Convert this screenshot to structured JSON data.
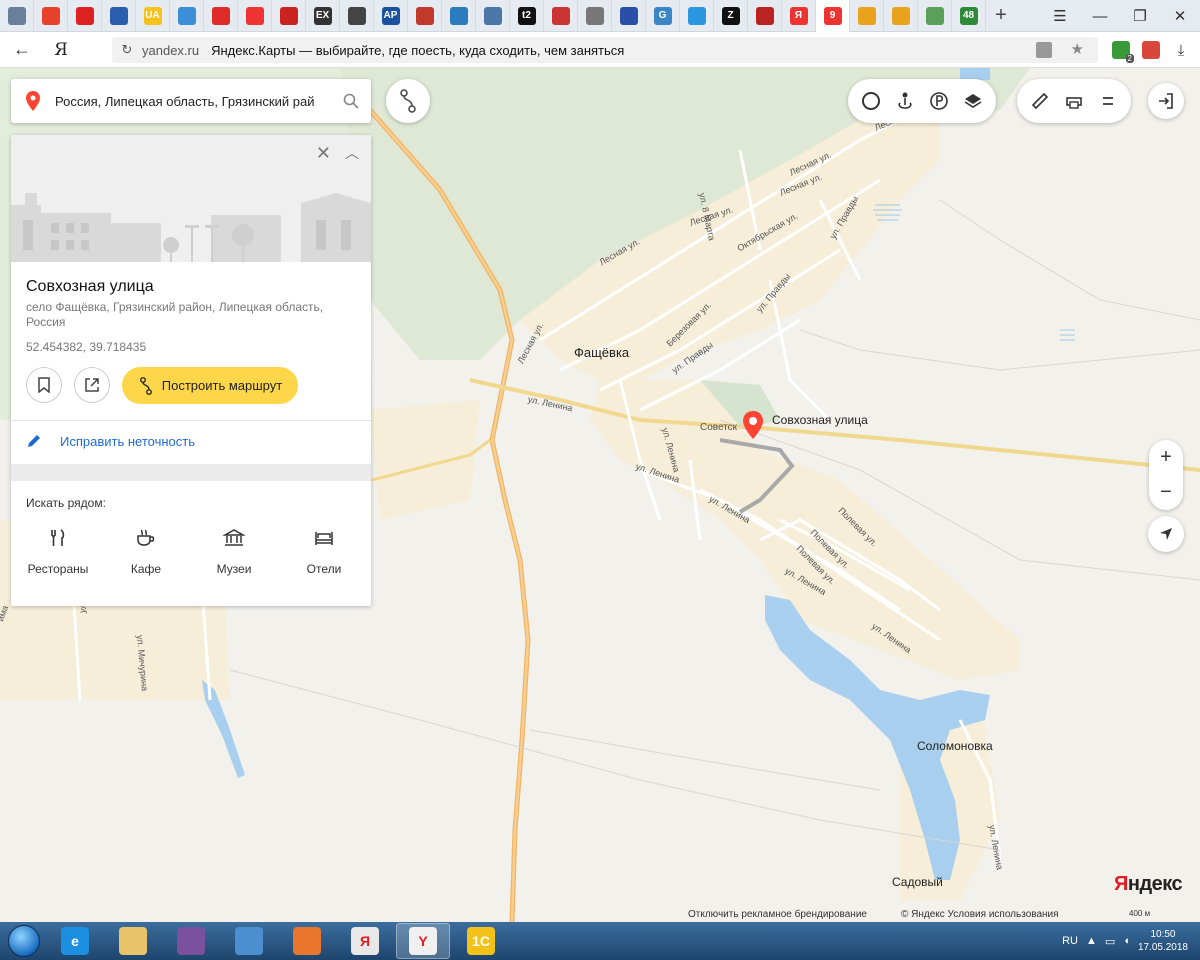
{
  "tabs": [
    {
      "icon": "cloud-icon",
      "label": "",
      "color": "#6a7f99"
    },
    {
      "icon": "ali-icon",
      "label": "",
      "color": "#e8412c"
    },
    {
      "icon": "cherry-icon",
      "label": "",
      "color": "#d22"
    },
    {
      "icon": "grid-icon",
      "label": "",
      "color": "#2b5eae"
    },
    {
      "icon": "ua-icon",
      "label": "UA",
      "color": "#f6c11a"
    },
    {
      "icon": "target-icon",
      "label": "",
      "color": "#3c8ed8"
    },
    {
      "icon": "video-icon",
      "label": "",
      "color": "#e02b2b"
    },
    {
      "icon": "lifebuoy-icon",
      "label": "",
      "color": "#e33"
    },
    {
      "icon": "star-icon",
      "label": "",
      "color": "#c22"
    },
    {
      "icon": "ex-icon",
      "label": "EX",
      "color": "#333"
    },
    {
      "icon": "bookmark-icon",
      "label": "",
      "color": "#444"
    },
    {
      "icon": "ap-icon",
      "label": "AP",
      "color": "#1a52a0"
    },
    {
      "icon": "flower-icon",
      "label": "",
      "color": "#c0392b"
    },
    {
      "icon": "shield-icon",
      "label": "",
      "color": "#2a7bbf"
    },
    {
      "icon": "vk-icon",
      "label": "",
      "color": "#4a76a8"
    },
    {
      "icon": "t2-icon",
      "label": "t2",
      "color": "#111"
    },
    {
      "icon": "globe-icon",
      "label": "",
      "color": "#c33"
    },
    {
      "icon": "document-icon",
      "label": "",
      "color": "#777"
    },
    {
      "icon": "flag-ru-icon",
      "label": "",
      "color": "#2a4fa8"
    },
    {
      "icon": "g-icon",
      "label": "G",
      "color": "#3b86c6"
    },
    {
      "icon": "dots-icon",
      "label": "",
      "color": "#2d96e0"
    },
    {
      "icon": "z-icon",
      "label": "Z",
      "color": "#111"
    },
    {
      "icon": "flag-uk-icon",
      "label": "",
      "color": "#b22"
    },
    {
      "icon": "yandex-icon",
      "label": "Я",
      "color": "#e33"
    },
    {
      "icon": "maps-pin-icon",
      "label": "9",
      "color": "#e33"
    },
    {
      "icon": "sunset-icon",
      "label": "",
      "color": "#e8a21c"
    },
    {
      "icon": "sunset-icon-2",
      "label": "",
      "color": "#e8a21c"
    },
    {
      "icon": "disk-icon",
      "label": "",
      "color": "#5aa05a"
    },
    {
      "icon": "number-icon",
      "label": "48",
      "color": "#2f8a3a"
    }
  ],
  "browser": {
    "new_tab": "+",
    "back": "←",
    "ya_button": "Я",
    "reload": "↻",
    "url_domain": "yandex.ru",
    "page_title": "Яндекс.Карты — выбирайте, где поесть, куда сходить, чем заняться",
    "star": "★",
    "ext_badge": "2"
  },
  "search": {
    "value": "Россия, Липецкая область, Грязинский рай"
  },
  "card": {
    "title": "Совхозная улица",
    "address": "село Фащёвка, Грязинский район, Липецкая область, Россия",
    "coords": "52.454382, 39.718435",
    "route_button": "Построить маршрут",
    "fix_inaccuracy": "Исправить неточность",
    "nearby_title": "Искать рядом:",
    "nearby": [
      {
        "label": "Рестораны",
        "icon": "fork-knife-icon"
      },
      {
        "label": "Кафе",
        "icon": "cup-icon"
      },
      {
        "label": "Музеи",
        "icon": "museum-icon"
      },
      {
        "label": "Отели",
        "icon": "bed-icon"
      }
    ]
  },
  "map": {
    "marker_label": "Совхозная улица",
    "places": {
      "fashchevka": "Фащёвка",
      "solomonovka": "Соломоновка",
      "sadovy": "Садовый"
    },
    "streets": {
      "lesnaya1": "Лесная ул.",
      "lesnaya2": "Лесная ул.",
      "lesnaya3": "Лесная ул.",
      "lesnaya4": "Лесная ул.",
      "lesnaya5": "Лесная ул.",
      "lesnaya6": "Лесная ул.",
      "marta": "ул. 8 Марта",
      "oktyabrskaya": "Октябрьская ул.",
      "pravdy1": "ул. Правды",
      "pravdy2": "ул. Правды",
      "pravdy3": "ул. Правды",
      "berezovaya": "Березовая ул.",
      "lenina1": "ул. Ленина",
      "lenina2": "ул. Ленина",
      "lenina3": "ул. Ленина",
      "lenina4": "ул. Ленина",
      "lenina5": "ул. Ленина",
      "lenina6": "ул. Ленина",
      "lenina7": "ул. Ленина",
      "sovetskaya": "Советск",
      "polevaya1": "Полевая ул.",
      "polevaya2": "Полевая ул.",
      "polevaya3": "Полевая ул.",
      "michurina": "ул. Мичурина",
      "left_ma": "ул. Ма",
      "left_ima": "има"
    },
    "footer_branding": "Отключить рекламное брендирование",
    "footer_copyright": "© Яндекс Условия использования",
    "logo_ya": "Я",
    "logo_rest": "ндекс",
    "scale": "400 м",
    "zoom_in": "+",
    "zoom_out": "−"
  },
  "taskbar": {
    "apps": [
      {
        "name": "ie",
        "label": "e",
        "color": "#1d8fe0"
      },
      {
        "name": "explorer",
        "label": "",
        "color": "#e9c46a"
      },
      {
        "name": "viber",
        "label": "",
        "color": "#7b519d"
      },
      {
        "name": "speaker",
        "label": "",
        "color": "#4c8fd0"
      },
      {
        "name": "player",
        "label": "",
        "color": "#e8762c"
      },
      {
        "name": "yandex",
        "label": "Я",
        "color": "#e8e8e8"
      },
      {
        "name": "yandex-browser",
        "label": "Y",
        "color": "#f0f0f0"
      },
      {
        "name": "1c",
        "label": "1С",
        "color": "#f3c218"
      }
    ],
    "lang": "RU",
    "time": "10:50",
    "date": "17.05.2018"
  }
}
